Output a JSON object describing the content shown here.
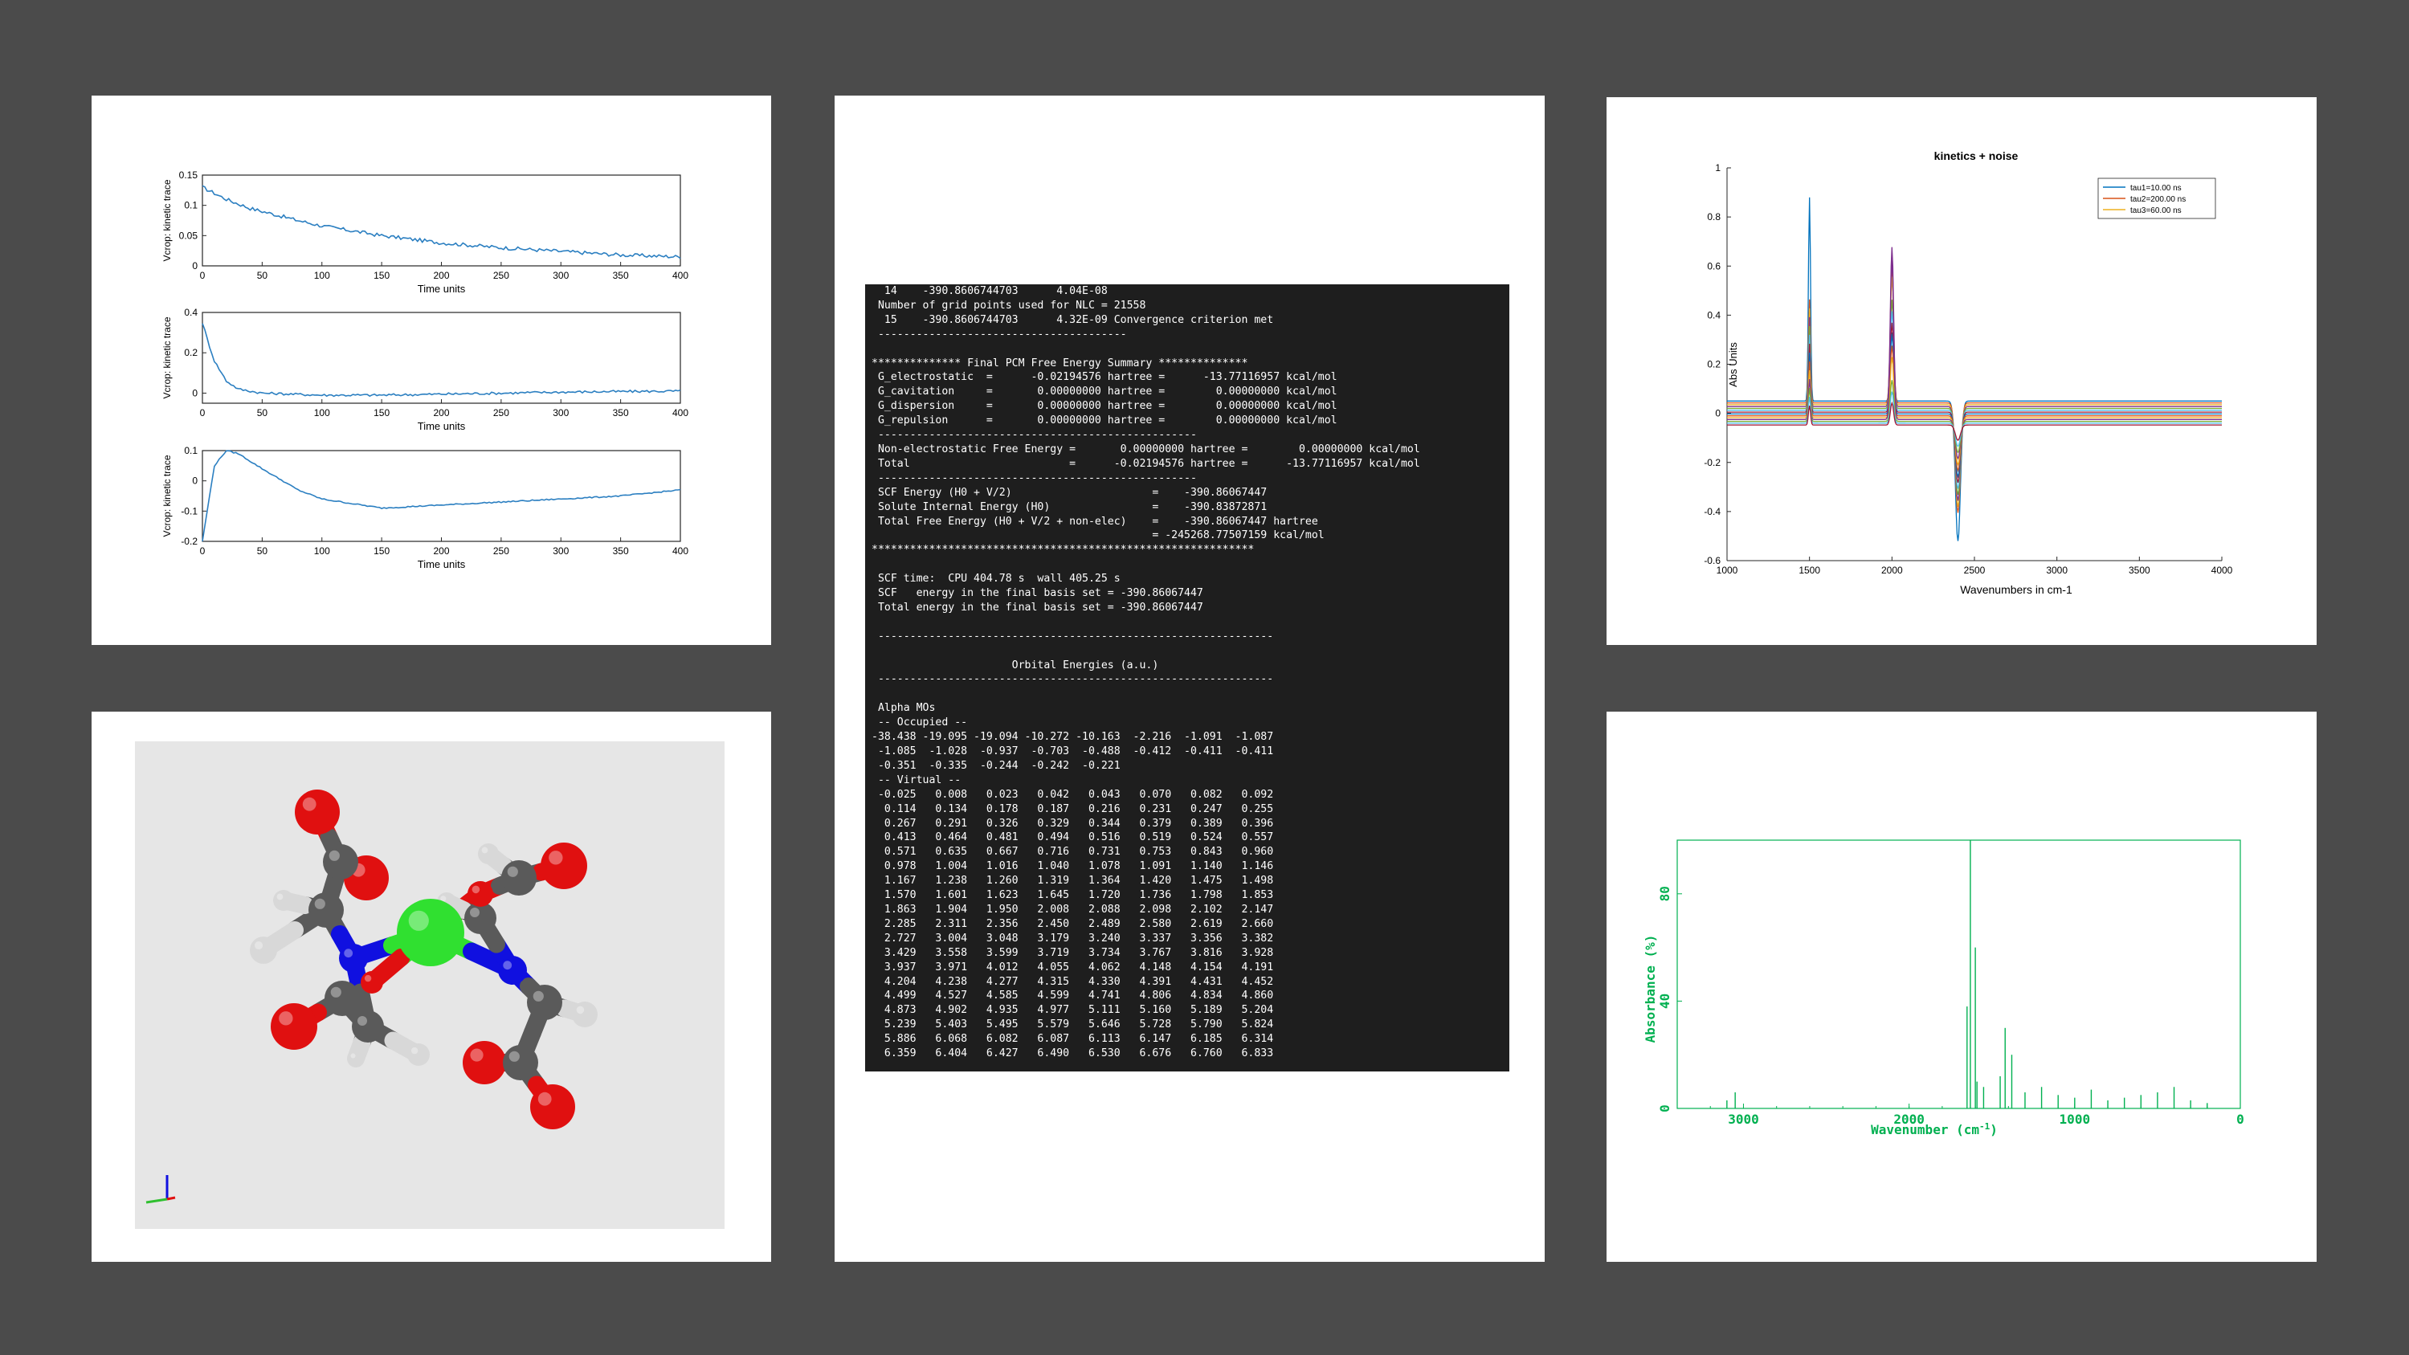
{
  "figures": {
    "kinetic_traces": {
      "ylabel": "Vcrop: kinetic trace",
      "xlabel": "Time units",
      "xticks": [
        "0",
        "50",
        "100",
        "150",
        "200",
        "250",
        "300",
        "350",
        "400"
      ],
      "plots": [
        {
          "yticks": [
            "0",
            "0.05",
            "0.1",
            "0.15"
          ],
          "ylim": [
            0,
            0.15
          ]
        },
        {
          "yticks": [
            "0",
            "0.2",
            "0.4"
          ],
          "ylim": [
            -0.05,
            0.4
          ]
        },
        {
          "yticks": [
            "-0.2",
            "-0.1",
            "0",
            "0.1"
          ],
          "ylim": [
            -0.2,
            0.1
          ]
        }
      ],
      "line_color": "#2b7fc1"
    },
    "terminal": {
      "lines": [
        "  14    -390.8606744703      4.04E-08",
        " Number of grid points used for NLC = 21558",
        "  15    -390.8606744703      4.32E-09 Convergence criterion met",
        " ---------------------------------------",
        "",
        "************** Final PCM Free Energy Summary **************",
        " G_electrostatic  =      -0.02194576 hartree =      -13.77116957 kcal/mol",
        " G_cavitation     =       0.00000000 hartree =        0.00000000 kcal/mol",
        " G_dispersion     =       0.00000000 hartree =        0.00000000 kcal/mol",
        " G_repulsion      =       0.00000000 hartree =        0.00000000 kcal/mol",
        " --------------------------------------------------",
        " Non-electrostatic Free Energy =       0.00000000 hartree =        0.00000000 kcal/mol",
        " Total                         =      -0.02194576 hartree =      -13.77116957 kcal/mol",
        " --------------------------------------------------",
        " SCF Energy (H0 + V/2)                      =    -390.86067447",
        " Solute Internal Energy (H0)                =    -390.83872871",
        " Total Free Energy (H0 + V/2 + non-elec)    =    -390.86067447 hartree",
        "                                            = -245268.77507159 kcal/mol",
        "************************************************************",
        "",
        " SCF time:  CPU 404.78 s  wall 405.25 s",
        " SCF   energy in the final basis set = -390.86067447",
        " Total energy in the final basis set = -390.86067447",
        "",
        " --------------------------------------------------------------",
        "",
        "                      Orbital Energies (a.u.)",
        " --------------------------------------------------------------",
        "",
        " Alpha MOs",
        " -- Occupied --",
        "-38.438 -19.095 -19.094 -10.272 -10.163  -2.216  -1.091  -1.087",
        " -1.085  -1.028  -0.937  -0.703  -0.488  -0.412  -0.411  -0.411",
        " -0.351  -0.335  -0.244  -0.242  -0.221",
        " -- Virtual --",
        " -0.025   0.008   0.023   0.042   0.043   0.070   0.082   0.092",
        "  0.114   0.134   0.178   0.187   0.216   0.231   0.247   0.255",
        "  0.267   0.291   0.326   0.329   0.344   0.379   0.389   0.396",
        "  0.413   0.464   0.481   0.494   0.516   0.519   0.524   0.557",
        "  0.571   0.635   0.667   0.716   0.731   0.753   0.843   0.960",
        "  0.978   1.004   1.016   1.040   1.078   1.091   1.140   1.146",
        "  1.167   1.238   1.260   1.319   1.364   1.420   1.475   1.498",
        "  1.570   1.601   1.623   1.645   1.720   1.736   1.798   1.853",
        "  1.863   1.904   1.950   2.008   2.088   2.098   2.102   2.147",
        "  2.285   2.311   2.356   2.450   2.489   2.580   2.619   2.660",
        "  2.727   3.004   3.048   3.179   3.240   3.337   3.356   3.382",
        "  3.429   3.558   3.599   3.719   3.734   3.767   3.816   3.928",
        "  3.937   3.971   4.012   4.055   4.062   4.148   4.154   4.191",
        "  4.204   4.238   4.277   4.315   4.330   4.391   4.431   4.452",
        "  4.499   4.527   4.585   4.599   4.741   4.806   4.834   4.860",
        "  4.873   4.902   4.935   4.977   5.111   5.160   5.189   5.204",
        "  5.239   5.403   5.495   5.579   5.646   5.728   5.790   5.824",
        "  5.886   6.068   6.082   6.087   6.113   6.147   6.185   6.314",
        "  6.359   6.404   6.427   6.490   6.530   6.676   6.760   6.833"
      ]
    },
    "kinetics_noise": {
      "title": "kinetics + noise",
      "xlabel": "Wavenumbers in cm-1",
      "ylabel": "Abs Units",
      "xticks": [
        "1000",
        "1500",
        "2000",
        "2500",
        "3000",
        "3500",
        "4000"
      ],
      "yticks": [
        "-0.6",
        "-0.4",
        "-0.2",
        "0",
        "0.2",
        "0.4",
        "0.6",
        "0.8",
        "1"
      ],
      "legend": [
        "tau1=10.00 ns",
        "tau2=200.00 ns",
        "tau3=60.00 ns"
      ],
      "legend_colors": [
        "#0072bd",
        "#d95319",
        "#edb120"
      ]
    },
    "molecule": {
      "atom_colors": {
        "carbon": "#5a5a5a",
        "oxygen": "#e01010",
        "nitrogen": "#1010e0",
        "central": "#30e030",
        "hydrogen": "#d8d8d8"
      }
    },
    "ir_spectrum": {
      "xlabel": "Wavenumber (cm",
      "xlabel_sup": "-1",
      "xlabel_end": ")",
      "ylabel": "Absorbance (%)",
      "xticks": [
        "3000",
        "2000",
        "1000",
        "0"
      ],
      "yticks": [
        "0",
        "40",
        "80"
      ],
      "color": "#00b050"
    }
  },
  "chart_data": [
    {
      "type": "line",
      "title": "",
      "xlabel": "Time units",
      "ylabel": "Vcrop: kinetic trace",
      "xlim": [
        0,
        400
      ],
      "ylim": [
        0,
        0.15
      ],
      "x": [
        0,
        20,
        40,
        60,
        80,
        100,
        150,
        200,
        250,
        300,
        350,
        400
      ],
      "values": [
        0.13,
        0.11,
        0.095,
        0.085,
        0.075,
        0.066,
        0.05,
        0.038,
        0.03,
        0.024,
        0.018,
        0.015
      ]
    },
    {
      "type": "line",
      "title": "",
      "xlabel": "Time units",
      "ylabel": "Vcrop: kinetic trace",
      "xlim": [
        0,
        400
      ],
      "ylim": [
        -0.05,
        0.4
      ],
      "x": [
        0,
        5,
        10,
        20,
        30,
        50,
        100,
        150,
        200,
        250,
        300,
        350,
        400
      ],
      "values": [
        0.35,
        0.25,
        0.16,
        0.06,
        0.02,
        0.0,
        -0.01,
        -0.01,
        -0.005,
        0.0,
        0.005,
        0.008,
        0.01
      ]
    },
    {
      "type": "line",
      "title": "",
      "xlabel": "Time units",
      "ylabel": "Vcrop: kinetic trace",
      "xlim": [
        0,
        400
      ],
      "ylim": [
        -0.2,
        0.1
      ],
      "x": [
        0,
        10,
        20,
        30,
        50,
        80,
        100,
        150,
        200,
        250,
        300,
        350,
        400
      ],
      "values": [
        -0.2,
        0.05,
        0.1,
        0.09,
        0.04,
        -0.03,
        -0.06,
        -0.09,
        -0.08,
        -0.07,
        -0.06,
        -0.05,
        -0.03
      ]
    },
    {
      "type": "line",
      "title": "kinetics + noise",
      "xlabel": "Wavenumbers in cm-1",
      "ylabel": "Abs Units",
      "xlim": [
        1000,
        4000
      ],
      "ylim": [
        -0.6,
        1
      ],
      "peaks": [
        {
          "x": 1500,
          "max": 0.88
        },
        {
          "x": 2000,
          "max": 0.65
        },
        {
          "x": 2400,
          "min": -0.52
        }
      ],
      "series": [
        {
          "name": "tau1=10.00 ns"
        },
        {
          "name": "tau2=200.00 ns"
        },
        {
          "name": "tau3=60.00 ns"
        }
      ]
    },
    {
      "type": "bar",
      "title": "",
      "xlabel": "Wavenumber (cm-1)",
      "ylabel": "Absorbance (%)",
      "xlim": [
        3400,
        0
      ],
      "ylim": [
        0,
        100
      ],
      "x": [
        3100,
        3050,
        1650,
        1630,
        1600,
        1590,
        1550,
        1450,
        1420,
        1380,
        1300,
        1200,
        1100,
        1000,
        900,
        800,
        700,
        600,
        500,
        400,
        300,
        200
      ],
      "values": [
        3,
        6,
        38,
        100,
        60,
        10,
        8,
        12,
        30,
        20,
        6,
        8,
        5,
        4,
        7,
        3,
        4,
        5,
        6,
        8,
        3,
        2
      ]
    }
  ]
}
